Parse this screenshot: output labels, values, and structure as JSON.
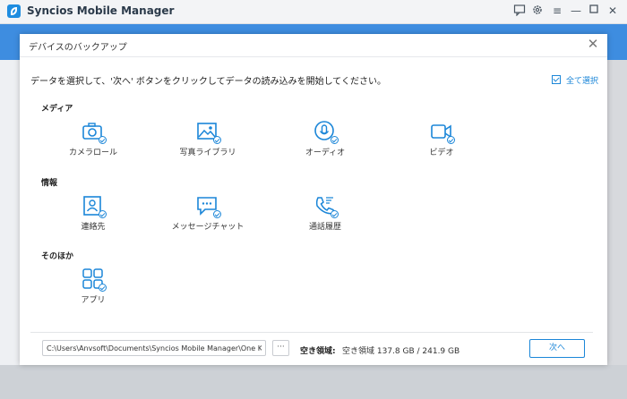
{
  "app": {
    "title": "Syncios Mobile Manager"
  },
  "window_controls": [
    "message-icon",
    "gear-icon",
    "menu-icon",
    "minimize-icon",
    "maximize-icon",
    "close-icon"
  ],
  "dialog": {
    "title": "デバイスのバックアップ",
    "instruction": "データを選択して、'次へ' ボタンをクリックしてデータの読み込みを開始してください。",
    "select_all": "全て選択",
    "sections": {
      "media": {
        "title": "メディア",
        "items": [
          {
            "label": "カメラロール",
            "icon": "camera-icon"
          },
          {
            "label": "写真ライブラリ",
            "icon": "image-icon"
          },
          {
            "label": "オーディオ",
            "icon": "microphone-icon"
          },
          {
            "label": "ビデオ",
            "icon": "video-icon"
          }
        ]
      },
      "info": {
        "title": "情報",
        "items": [
          {
            "label": "連絡先",
            "icon": "contacts-icon"
          },
          {
            "label": "メッセージチャット",
            "icon": "chat-icon"
          },
          {
            "label": "通話履歴",
            "icon": "phone-icon"
          }
        ]
      },
      "other": {
        "title": "そのほか",
        "items": [
          {
            "label": "アプリ",
            "icon": "apps-icon"
          }
        ]
      }
    },
    "footer": {
      "path": "C:\\Users\\Anvsoft\\Documents\\Syncios Mobile Manager\\One Key Backu",
      "browse": "···",
      "space_label": "空き領域:",
      "space_value": "空き領域 137.8 GB / 241.9 GB",
      "next": "次へ"
    }
  },
  "colors": {
    "accent": "#1b86d8",
    "titlebar_blue": "#3e8de0"
  }
}
